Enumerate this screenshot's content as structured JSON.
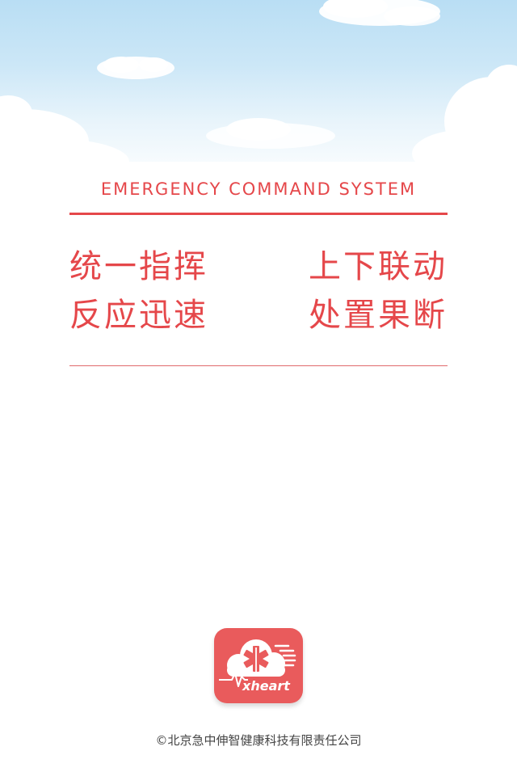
{
  "header": {
    "title_en": "EMERGENCY COMMAND SYSTEM"
  },
  "slogans": [
    {
      "left": "统一指挥",
      "right": "上下联动"
    },
    {
      "left": "反应迅速",
      "right": "处置果断"
    }
  ],
  "logo": {
    "icon": "star-of-life-cloud-icon",
    "wordmark": "xheart"
  },
  "footer": {
    "copyright": "©北京急中伸智健康科技有限责任公司"
  },
  "colors": {
    "accent": "#e5474a",
    "logo_bg": "#e95b5c",
    "sky_top": "#b9def4"
  }
}
